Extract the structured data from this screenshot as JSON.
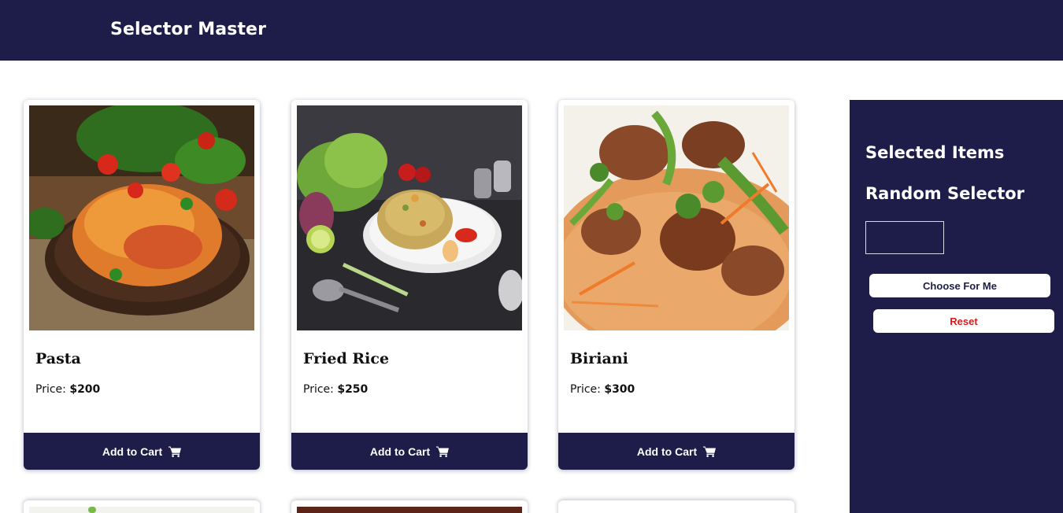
{
  "header": {
    "title": "Selector Master"
  },
  "products": [
    {
      "name": "Pasta",
      "price_label": "Price:",
      "price": "$200",
      "button": "Add to Cart"
    },
    {
      "name": "Fried Rice",
      "price_label": "Price:",
      "price": "$250",
      "button": "Add to Cart"
    },
    {
      "name": "Biriani",
      "price_label": "Price:",
      "price": "$300",
      "button": "Add to Cart"
    }
  ],
  "sidebar": {
    "selected_heading": "Selected Items",
    "random_heading": "Random Selector",
    "picked_value": "",
    "choose_label": "Choose For Me",
    "reset_label": "Reset"
  },
  "colors": {
    "navy": "#1e1c48",
    "reset_red": "#e01818",
    "white": "#ffffff"
  },
  "icons": {
    "cart": "shopping-cart-icon"
  }
}
